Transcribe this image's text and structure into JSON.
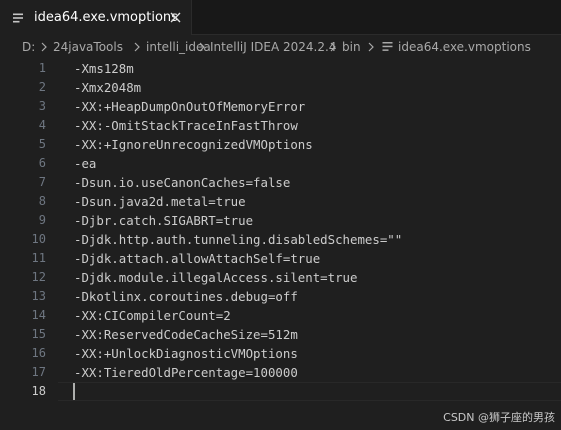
{
  "tab": {
    "label": "idea64.exe.vmoptions",
    "file_icon": "file-lines-icon",
    "close_icon": "close-icon"
  },
  "breadcrumb": {
    "items": [
      "D:",
      "24javaTools",
      "intelli_idea",
      "IntelliJ IDEA 2024.2.4",
      "bin",
      "idea64.exe.vmoptions"
    ],
    "separator_icon": "chevron-right-icon"
  },
  "editor": {
    "active_line": 18,
    "lines": [
      {
        "number": "1",
        "text": "-Xms128m"
      },
      {
        "number": "2",
        "text": "-Xmx2048m"
      },
      {
        "number": "3",
        "text": "-XX:+HeapDumpOnOutOfMemoryError"
      },
      {
        "number": "4",
        "text": "-XX:-OmitStackTraceInFastThrow"
      },
      {
        "number": "5",
        "text": "-XX:+IgnoreUnrecognizedVMOptions"
      },
      {
        "number": "6",
        "text": "-ea"
      },
      {
        "number": "7",
        "text": "-Dsun.io.useCanonCaches=false"
      },
      {
        "number": "8",
        "text": "-Dsun.java2d.metal=true"
      },
      {
        "number": "9",
        "text": "-Djbr.catch.SIGABRT=true"
      },
      {
        "number": "10",
        "text": "-Djdk.http.auth.tunneling.disabledSchemes=\"\""
      },
      {
        "number": "11",
        "text": "-Djdk.attach.allowAttachSelf=true"
      },
      {
        "number": "12",
        "text": "-Djdk.module.illegalAccess.silent=true"
      },
      {
        "number": "13",
        "text": "-Dkotlinx.coroutines.debug=off"
      },
      {
        "number": "14",
        "text": "-XX:CICompilerCount=2"
      },
      {
        "number": "15",
        "text": "-XX:ReservedCodeCacheSize=512m"
      },
      {
        "number": "16",
        "text": "-XX:+UnlockDiagnosticVMOptions"
      },
      {
        "number": "17",
        "text": "-XX:TieredOldPercentage=100000"
      },
      {
        "number": "18",
        "text": ""
      }
    ]
  },
  "watermark": "CSDN @狮子座的男孩",
  "colors": {
    "background": "#1f1f1f",
    "tabbar": "#181818",
    "text": "#cccccc",
    "line_number": "#6e7681"
  }
}
